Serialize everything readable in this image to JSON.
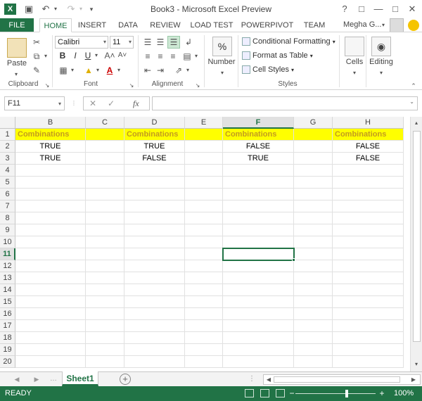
{
  "window": {
    "title": "Book3 - Microsoft Excel Preview",
    "help_label": "?",
    "app_logo": "X"
  },
  "ribbon_tabs": [
    {
      "label": "FILE"
    },
    {
      "label": "HOME"
    },
    {
      "label": "INSERT"
    },
    {
      "label": "DATA"
    },
    {
      "label": "REVIEW"
    },
    {
      "label": "LOAD TEST"
    },
    {
      "label": "POWERPIVOT"
    },
    {
      "label": "TEAM"
    }
  ],
  "user": {
    "name": "Megha G..."
  },
  "ribbon": {
    "clipboard": {
      "paste_label": "Paste",
      "group_label": "Clipboard"
    },
    "font": {
      "font_name": "Calibri",
      "font_size": "11",
      "group_label": "Font",
      "bold": "B",
      "italic": "I",
      "underline": "U",
      "font_color": "A"
    },
    "alignment": {
      "group_label": "Alignment"
    },
    "number": {
      "label": "Number",
      "icon_text": "%"
    },
    "styles": {
      "conditional": "Conditional Formatting",
      "format_table": "Format as Table",
      "cell_styles": "Cell Styles",
      "group_label": "Styles"
    },
    "cells": {
      "label": "Cells"
    },
    "editing": {
      "label": "Editing"
    }
  },
  "formula_bar": {
    "name_box": "F11",
    "fx_label": "fx",
    "value": ""
  },
  "sheet": {
    "columns": [
      "B",
      "C",
      "D",
      "E",
      "F",
      "G",
      "H"
    ],
    "selected_column": "F",
    "rows": [
      "1",
      "2",
      "3",
      "4",
      "5",
      "6",
      "7",
      "8",
      "9",
      "10",
      "11",
      "12",
      "13",
      "14",
      "15",
      "16",
      "17",
      "18",
      "19",
      "20"
    ],
    "selected_row": "11",
    "cells": {
      "B1": "Combinations",
      "D1": "Combinations",
      "F1": "Combinations",
      "H1": "Combinations",
      "B2": "TRUE",
      "D2": "TRUE",
      "F2": "FALSE",
      "H2": "FALSE",
      "B3": "TRUE",
      "D3": "FALSE",
      "F3": "TRUE",
      "H3": "FALSE"
    },
    "header_fill": "#ffff00",
    "header_text_color": "#c39b1f"
  },
  "sheet_tabs": [
    {
      "label": "Sheet1"
    }
  ],
  "status": {
    "text": "READY",
    "zoom": "100%",
    "zoom_level": 1.0
  },
  "colors": {
    "accent": "#217346"
  }
}
